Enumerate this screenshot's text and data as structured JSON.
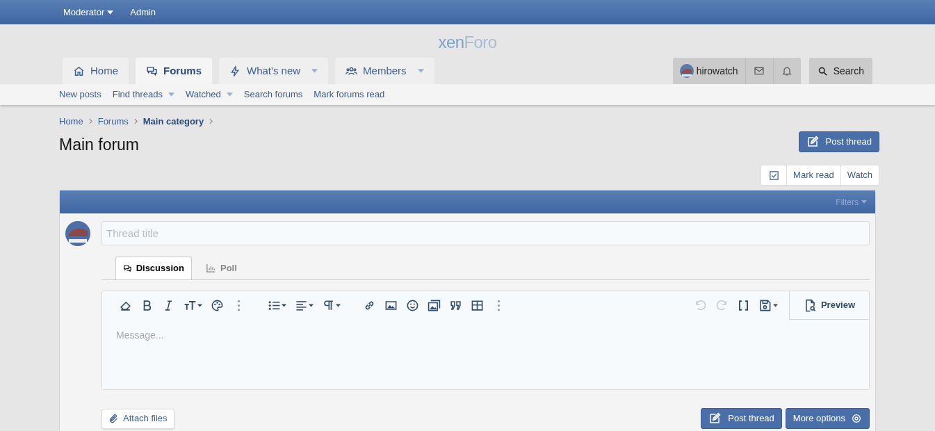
{
  "top_bar": {
    "items": [
      {
        "label": "Moderator",
        "has_menu": true
      },
      {
        "label": "Admin",
        "has_menu": false
      }
    ]
  },
  "logo": [
    "xen",
    "Foro"
  ],
  "nav_tabs": [
    {
      "label": "Home",
      "selected": false,
      "has_menu": false
    },
    {
      "label": "Forums",
      "selected": true,
      "has_menu": false
    },
    {
      "label": "What's new",
      "selected": false,
      "has_menu": true
    },
    {
      "label": "Members",
      "selected": false,
      "has_menu": true
    }
  ],
  "user_bar": {
    "username": "hirowatch",
    "search": "Search"
  },
  "sub_nav": [
    {
      "label": "New posts",
      "has_menu": false
    },
    {
      "label": "Find threads",
      "has_menu": true
    },
    {
      "label": "Watched",
      "has_menu": true
    },
    {
      "label": "Search forums",
      "has_menu": false
    },
    {
      "label": "Mark forums read",
      "has_menu": false
    }
  ],
  "breadcrumbs": [
    {
      "label": "Home",
      "current": false
    },
    {
      "label": "Forums",
      "current": false
    },
    {
      "label": "Main category",
      "current": true
    }
  ],
  "page_title": "Main forum",
  "post_thread_button": "Post thread",
  "actions": [
    "Mark read",
    "Watch"
  ],
  "block": {
    "filters": "Filters",
    "thread_title_placeholder": "Thread title",
    "editor_tabs": [
      {
        "label": "Discussion",
        "selected": true
      },
      {
        "label": "Poll",
        "selected": false
      }
    ],
    "toolbar_left": [
      {
        "kind": "eraser",
        "has_menu": false
      },
      {
        "kind": "bold",
        "has_menu": false
      },
      {
        "kind": "italic",
        "has_menu": false
      },
      {
        "kind": "textsize",
        "has_menu": true
      },
      {
        "kind": "palette",
        "has_menu": false
      },
      {
        "kind": "more",
        "has_menu": false
      },
      {
        "kind": "list",
        "has_menu": true
      },
      {
        "kind": "align",
        "has_menu": true
      },
      {
        "kind": "paragraph",
        "has_menu": true
      },
      {
        "kind": "link",
        "has_menu": false
      },
      {
        "kind": "image",
        "has_menu": false
      },
      {
        "kind": "smiley",
        "has_menu": false
      },
      {
        "kind": "media",
        "has_menu": false
      },
      {
        "kind": "quote",
        "has_menu": false
      },
      {
        "kind": "table",
        "has_menu": false
      },
      {
        "kind": "more",
        "has_menu": false
      }
    ],
    "toolbar_right": [
      {
        "kind": "undo",
        "disabled": true,
        "has_menu": false
      },
      {
        "kind": "redo",
        "disabled": true,
        "has_menu": false
      },
      {
        "kind": "brackets",
        "disabled": false,
        "has_menu": false
      },
      {
        "kind": "save",
        "disabled": false,
        "has_menu": true
      }
    ],
    "preview": "Preview",
    "message_placeholder": "Message...",
    "attach": "Attach files",
    "submit": "Post thread",
    "more_options": "More options"
  }
}
